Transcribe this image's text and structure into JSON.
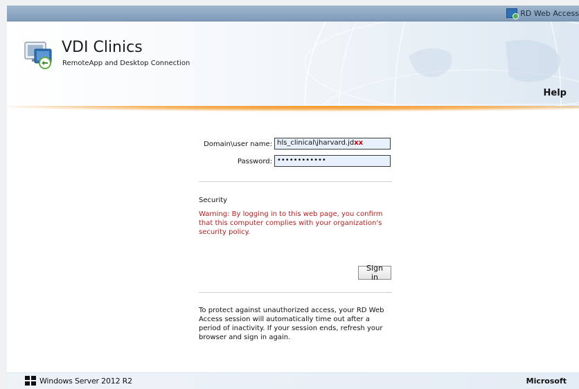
{
  "topbar": {
    "title": "RD Web Access"
  },
  "header": {
    "title": "VDI Clinics",
    "subtitle": "RemoteApp and Desktop Connection",
    "help_label": "Help"
  },
  "form": {
    "username_label": "Domain\\user name:",
    "username_value": "hls_clinical\\jharvard.jd",
    "username_value_suffix": "xx",
    "password_label": "Password:",
    "password_value": "••••••••••••",
    "security_heading": "Security",
    "security_warning": "Warning: By logging in to this web page, you confirm that this computer complies with your organization's security policy.",
    "signin_label": "Sign in",
    "timeout_note": "To protect against unauthorized access, your RD Web Access session will automatically time out after a period of inactivity. If your session ends, refresh your browser and sign in again."
  },
  "footer": {
    "os_label": "Windows Server 2012 R2",
    "company_label": "Microsoft"
  },
  "colors": {
    "warning_text": "#b52020",
    "accent_orange": "#f39423",
    "field_background": "#e8f0fb"
  }
}
